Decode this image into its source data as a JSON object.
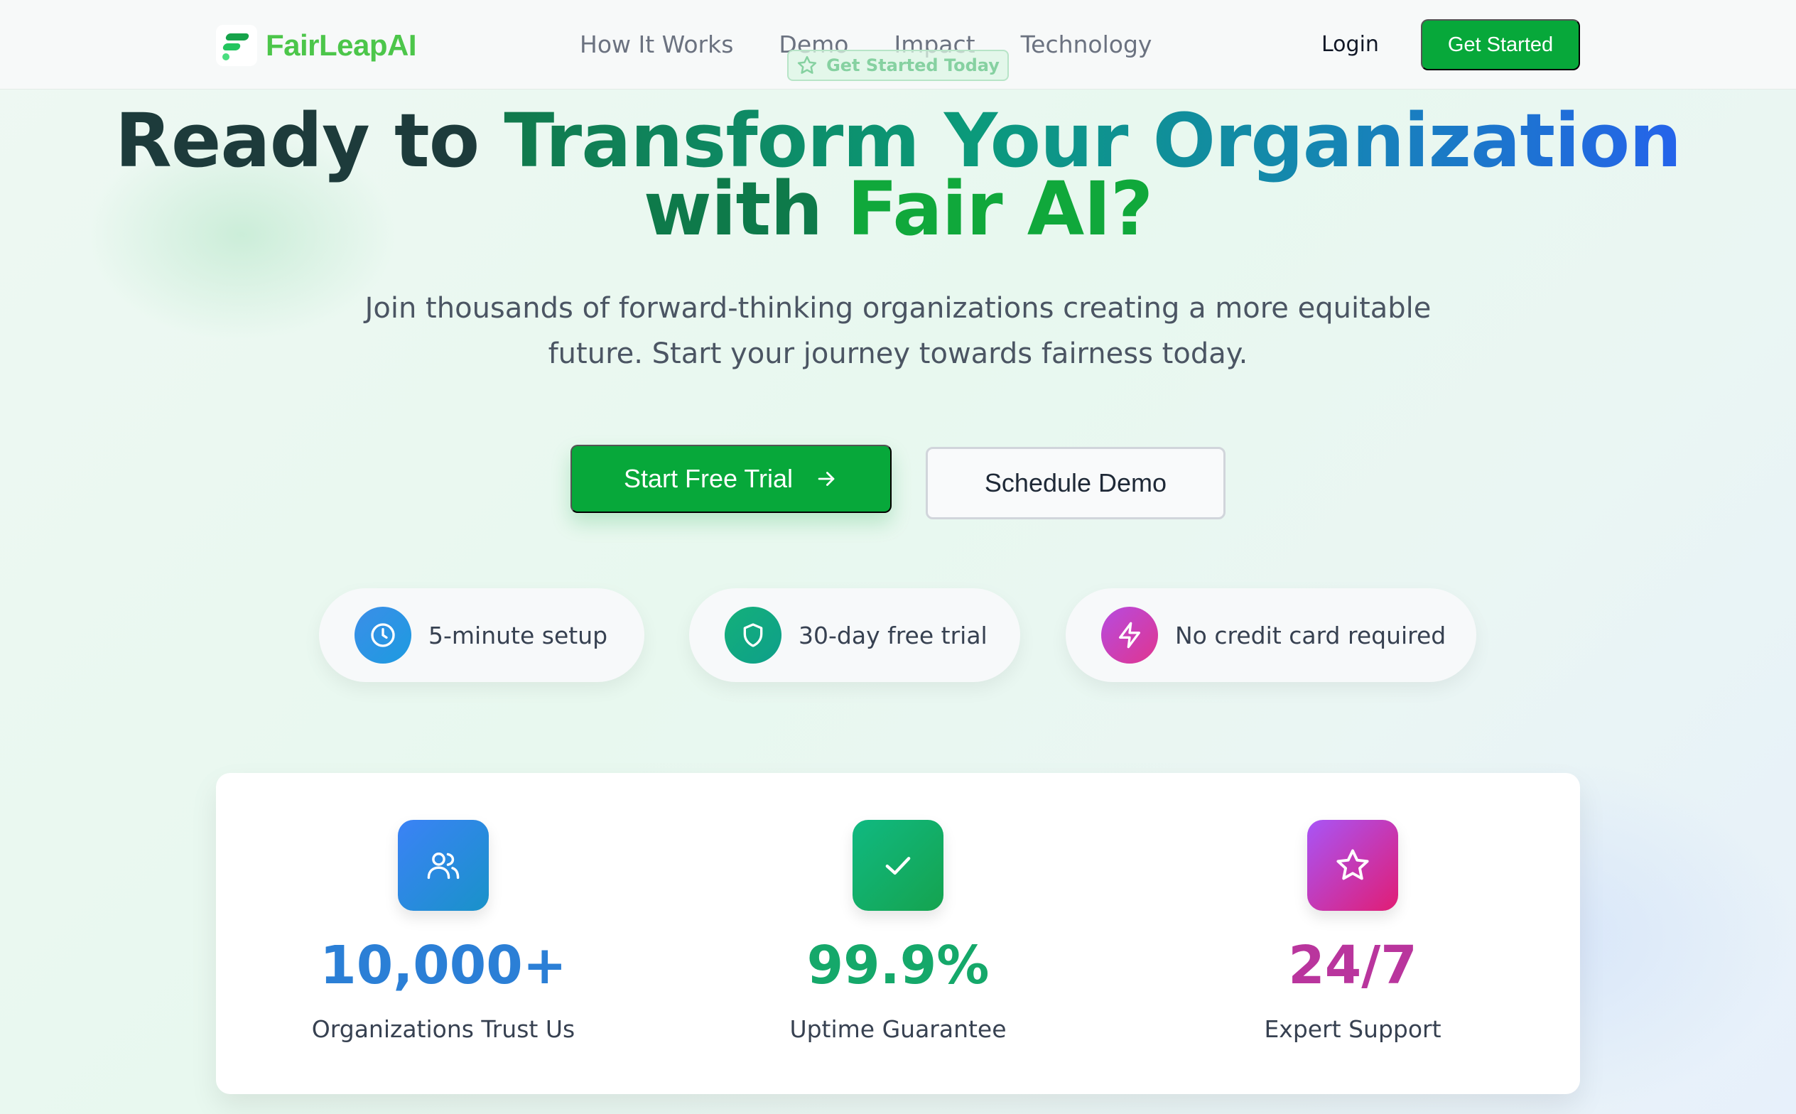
{
  "nav": {
    "brand": "FairLeapAI",
    "links": [
      "How It Works",
      "Demo",
      "Impact",
      "Technology"
    ],
    "badge": "Get Started Today",
    "login": "Login",
    "cta": "Get Started"
  },
  "hero": {
    "headline_part1": "Ready to ",
    "headline_part2": "Transform Your Organization",
    "headline_part3": "with ",
    "headline_part4": "Fair AI?",
    "subtitle_line1": "Join thousands of forward-thinking organizations creating a more equitable",
    "subtitle_line2": "future. Start your journey towards fairness today.",
    "primary_button": "Start Free Trial",
    "secondary_button": "Schedule Demo"
  },
  "features": [
    {
      "label": "5-minute setup",
      "icon": "clock-icon"
    },
    {
      "label": "30-day free trial",
      "icon": "shield-icon"
    },
    {
      "label": "No credit card required",
      "icon": "lightning-icon"
    }
  ],
  "stats": [
    {
      "value": "10,000+",
      "label": "Organizations Trust Us",
      "icon": "users-icon",
      "color": "#2b7fd6"
    },
    {
      "value": "99.9%",
      "label": "Uptime Guarantee",
      "icon": "check-icon",
      "color": "#15a86a"
    },
    {
      "value": "24/7",
      "label": "Expert Support",
      "icon": "star-icon",
      "color": "#b9359d"
    }
  ],
  "colors": {
    "accent_green": "#07a83a",
    "brand_green": "#4cc64a"
  }
}
